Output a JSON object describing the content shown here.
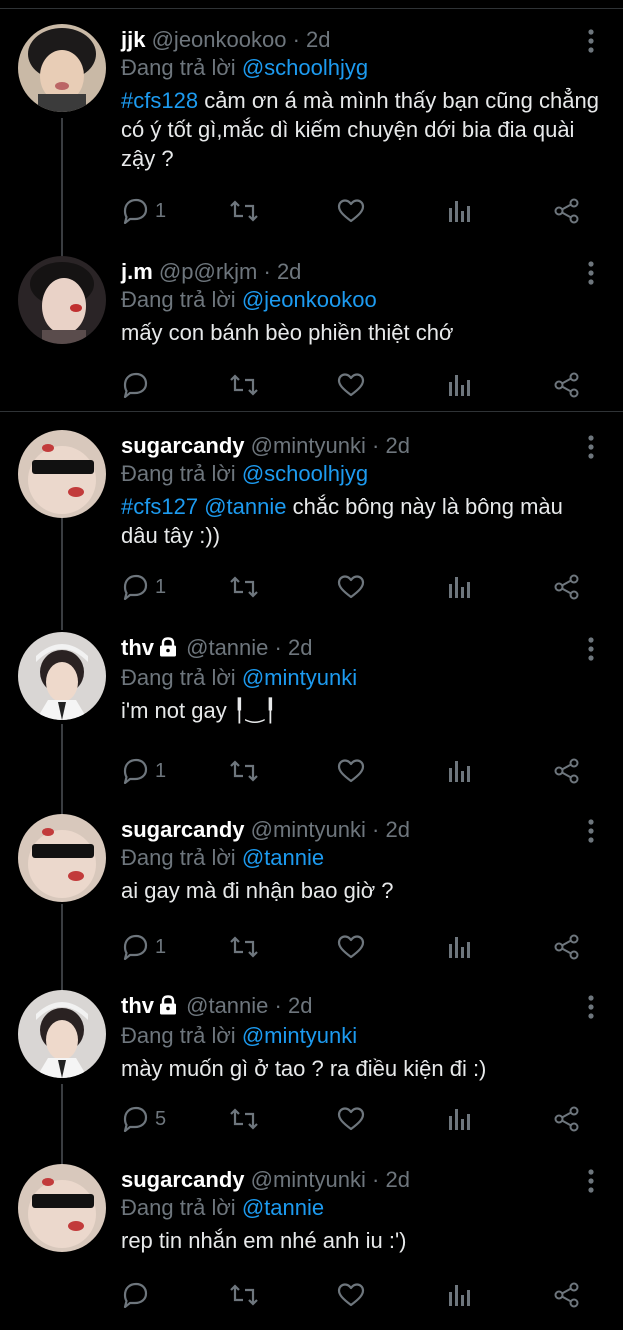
{
  "tweets": [
    {
      "name": "jjk",
      "handle": "@jeonkookoo",
      "time": "2d",
      "reply_prefix": "Đang trả lời",
      "reply_to": "@schoolhjyg",
      "hashtag": "#cfs128",
      "mention": "",
      "text": "cảm ơn á mà mình thấy bạn cũng chẳng có ý tốt gì,mắc dì kiếm chuyện dới bia đia quài zậy ?",
      "reply_count": "1",
      "avatar": "jjk-avatar",
      "locked": false
    },
    {
      "name": "j.m",
      "handle": "@p@rkjm",
      "time": "2d",
      "reply_prefix": "Đang trả lời",
      "reply_to": "@jeonkookoo",
      "hashtag": "",
      "mention": "",
      "text": "mấy con bánh bèo phiền thiệt chớ",
      "reply_count": "",
      "avatar": "jm-avatar",
      "locked": false
    },
    {
      "name": "sugarcandy",
      "handle": "@mintyunki",
      "time": "2d",
      "reply_prefix": "Đang trả lời",
      "reply_to": "@schoolhjyg",
      "hashtag": "#cfs127",
      "mention": "@tannie",
      "text": "chắc bông này là bông màu dâu tây :))",
      "reply_count": "1",
      "avatar": "sugarcandy-avatar",
      "locked": false
    },
    {
      "name": "thv",
      "handle": "@tannie",
      "time": "2d",
      "reply_prefix": "Đang trả lời",
      "reply_to": "@mintyunki",
      "hashtag": "",
      "mention": "",
      "text": "i'm not gay ╿‿╿",
      "reply_count": "1",
      "avatar": "thv-avatar",
      "locked": true
    },
    {
      "name": "sugarcandy",
      "handle": "@mintyunki",
      "time": "2d",
      "reply_prefix": "Đang trả lời",
      "reply_to": "@tannie",
      "hashtag": "",
      "mention": "",
      "text": "ai gay mà đi nhận bao giờ ?",
      "reply_count": "1",
      "avatar": "sugarcandy-avatar",
      "locked": false
    },
    {
      "name": "thv",
      "handle": "@tannie",
      "time": "2d",
      "reply_prefix": "Đang trả lời",
      "reply_to": "@mintyunki",
      "hashtag": "",
      "mention": "",
      "text": "mày muốn gì ở tao ? ra điều kiện đi :)",
      "reply_count": "5",
      "avatar": "thv-avatar",
      "locked": true
    },
    {
      "name": "sugarcandy",
      "handle": "@mintyunki",
      "time": "2d",
      "reply_prefix": "Đang trả lời",
      "reply_to": "@tannie",
      "hashtag": "",
      "mention": "",
      "text": "rep tin nhắn em nhé anh iu :')",
      "reply_count": "",
      "avatar": "sugarcandy-avatar",
      "locked": false
    }
  ],
  "icons": {
    "reply": "reply-icon",
    "retweet": "retweet-icon",
    "like": "like-icon",
    "stats": "stats-icon",
    "share": "share-icon",
    "more": "more-icon",
    "lock": "lock-icon"
  },
  "colors": {
    "background": "#000000",
    "link": "#1d9bf0",
    "muted": "#6e767d",
    "text": "#e7e9ea"
  }
}
